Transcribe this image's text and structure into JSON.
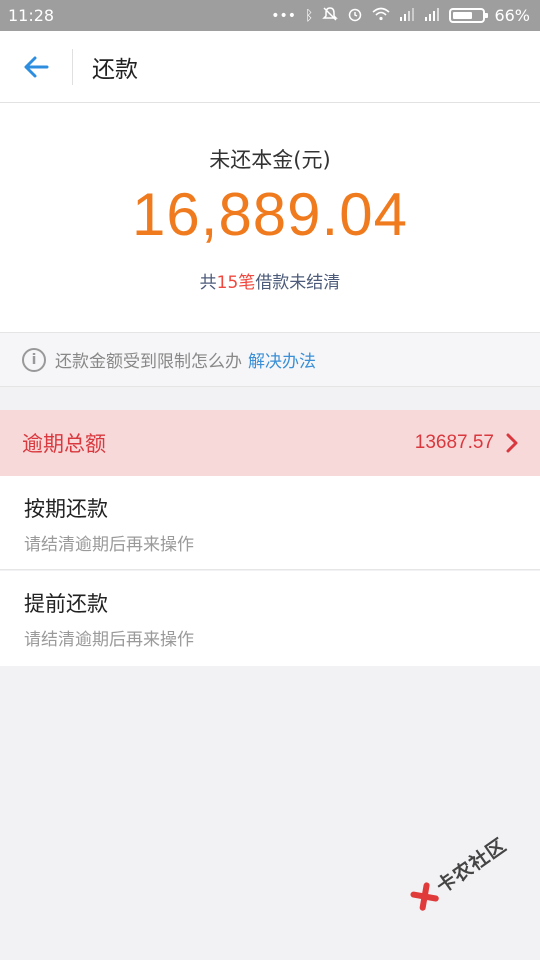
{
  "status_bar": {
    "time": "11:28",
    "battery": "66%",
    "battery_level": 0.66,
    "icons": [
      "dots-icon",
      "bluetooth-icon",
      "mute-icon",
      "alarm-icon",
      "wifi-icon",
      "signal-icon",
      "signal-icon",
      "battery-icon"
    ]
  },
  "header": {
    "title": "还款",
    "back_icon": "arrow-left-icon"
  },
  "summary": {
    "label": "未还本金(元)",
    "amount": "16,889.04",
    "count_prefix": "共",
    "count": "15笔",
    "count_suffix": "借款未结清",
    "amount_color": "#f07a1e",
    "highlight_color": "#f0483e"
  },
  "notice": {
    "icon": "info-icon",
    "text": "还款金额受到限制怎么办",
    "link": "解决办法"
  },
  "overdue": {
    "label": "逾期总额",
    "amount": "13687.57",
    "icon": "chevron-right-icon",
    "color": "#d9393e"
  },
  "options": [
    {
      "title": "按期还款",
      "subtitle": "请结清逾期后再来操作"
    },
    {
      "title": "提前还款",
      "subtitle": "请结清逾期后再来操作"
    }
  ],
  "watermark": {
    "text": "卡农社区"
  }
}
